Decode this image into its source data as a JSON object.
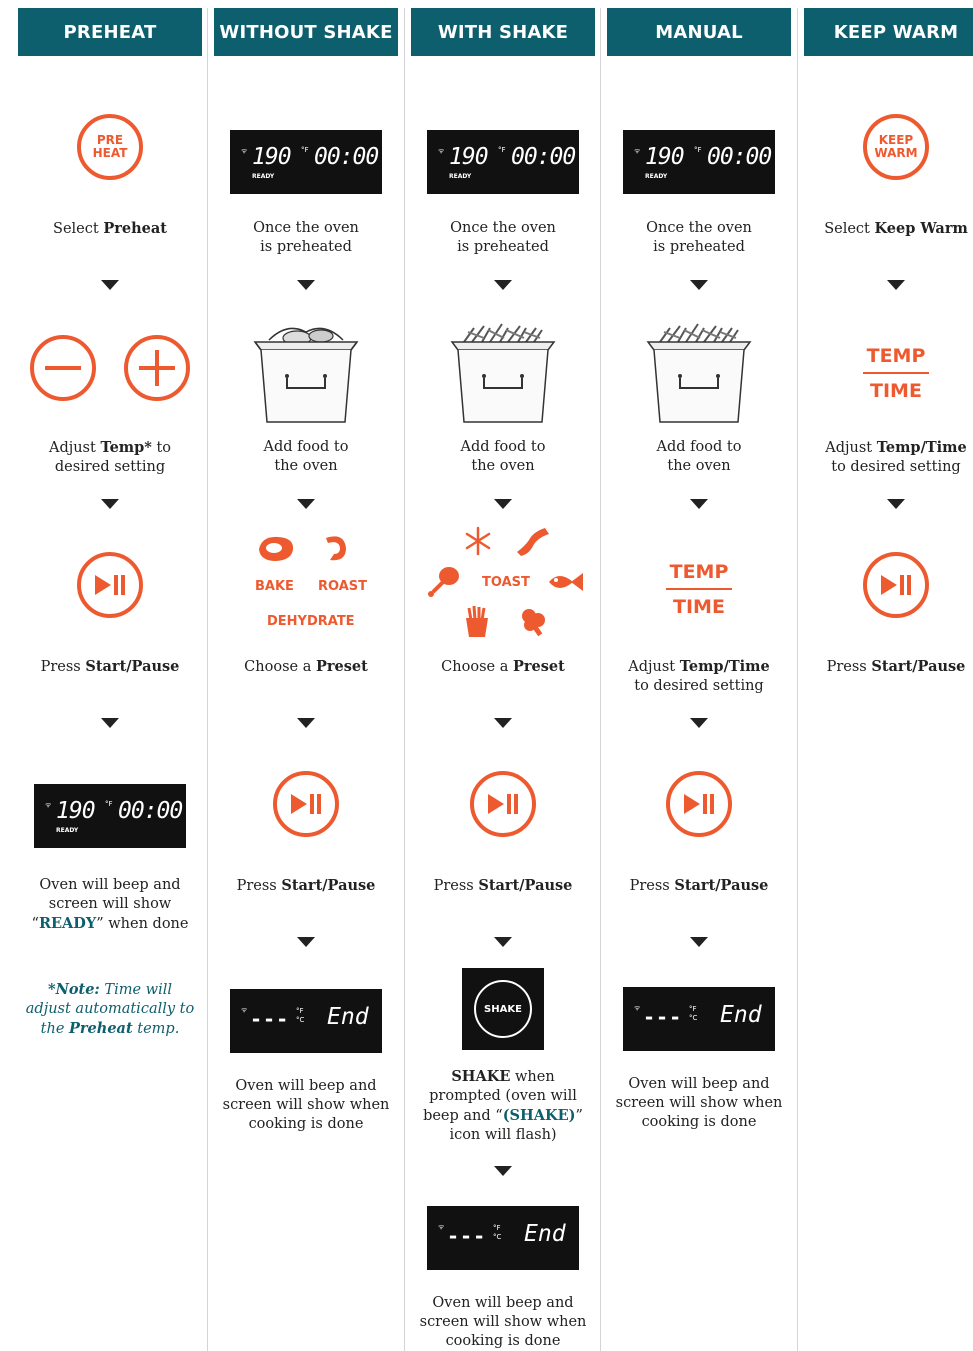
{
  "headers": [
    "PREHEAT",
    "WITHOUT SHAKE",
    "WITH SHAKE",
    "MANUAL",
    "KEEP WARM"
  ],
  "display": {
    "temp": "190",
    "time": "00:00",
    "unit_f": "°F",
    "unit_c": "°C",
    "ready": "READY",
    "dashes": "---",
    "end": "End"
  },
  "icons": {
    "preheat_line1": "PRE",
    "preheat_line2": "HEAT",
    "keepwarm_line1": "KEEP",
    "keepwarm_line2": "WARM",
    "temp": "TEMP",
    "time": "TIME",
    "shake": "SHAKE"
  },
  "presets_no_shake": {
    "bake": "BAKE",
    "roast": "ROAST",
    "dehydrate": "DEHYDRATE"
  },
  "presets_shake": {
    "toast": "TOAST"
  },
  "text": {
    "select": "Select ",
    "preheat": "Preheat",
    "keep_warm": "Keep Warm",
    "once_oven_1": "Once the oven",
    "once_oven_2": "is preheated",
    "adjust": "Adjust ",
    "temp_star": "Temp*",
    "to": " to",
    "desired_setting": "desired setting",
    "to_desired_setting": "to desired setting",
    "temp_time": "Temp/Time",
    "add_food_1": "Add food to",
    "add_food_2": "the oven",
    "press": "Press ",
    "start_pause": "Start/Pause",
    "choose_a": "Choose a ",
    "preset": "Preset",
    "beep_ready_1": "Oven will beep and",
    "beep_ready_2": "screen will show",
    "beep_ready_q1": "“",
    "beep_ready_ready": "READY",
    "beep_ready_q2": "” when done",
    "note_label": "*Note:",
    "note_1": " Time will",
    "note_2": "adjust automatically to",
    "note_3a": "the ",
    "note_3b": "Preheat",
    "note_3c": " temp.",
    "done_1": "Oven will beep and",
    "done_2": "screen will show when",
    "done_3": "cooking is done",
    "shake_bold": "SHAKE",
    "shake_1": " when",
    "shake_2": "prompted (oven will",
    "shake_3a": "beep and “",
    "shake_3b": "(SHAKE)",
    "shake_3c": "”",
    "shake_4": "icon will flash)"
  },
  "colors": {
    "header_bg": "#0e5f6d",
    "accent": "#ee5a2f",
    "display_bg": "#111111"
  }
}
